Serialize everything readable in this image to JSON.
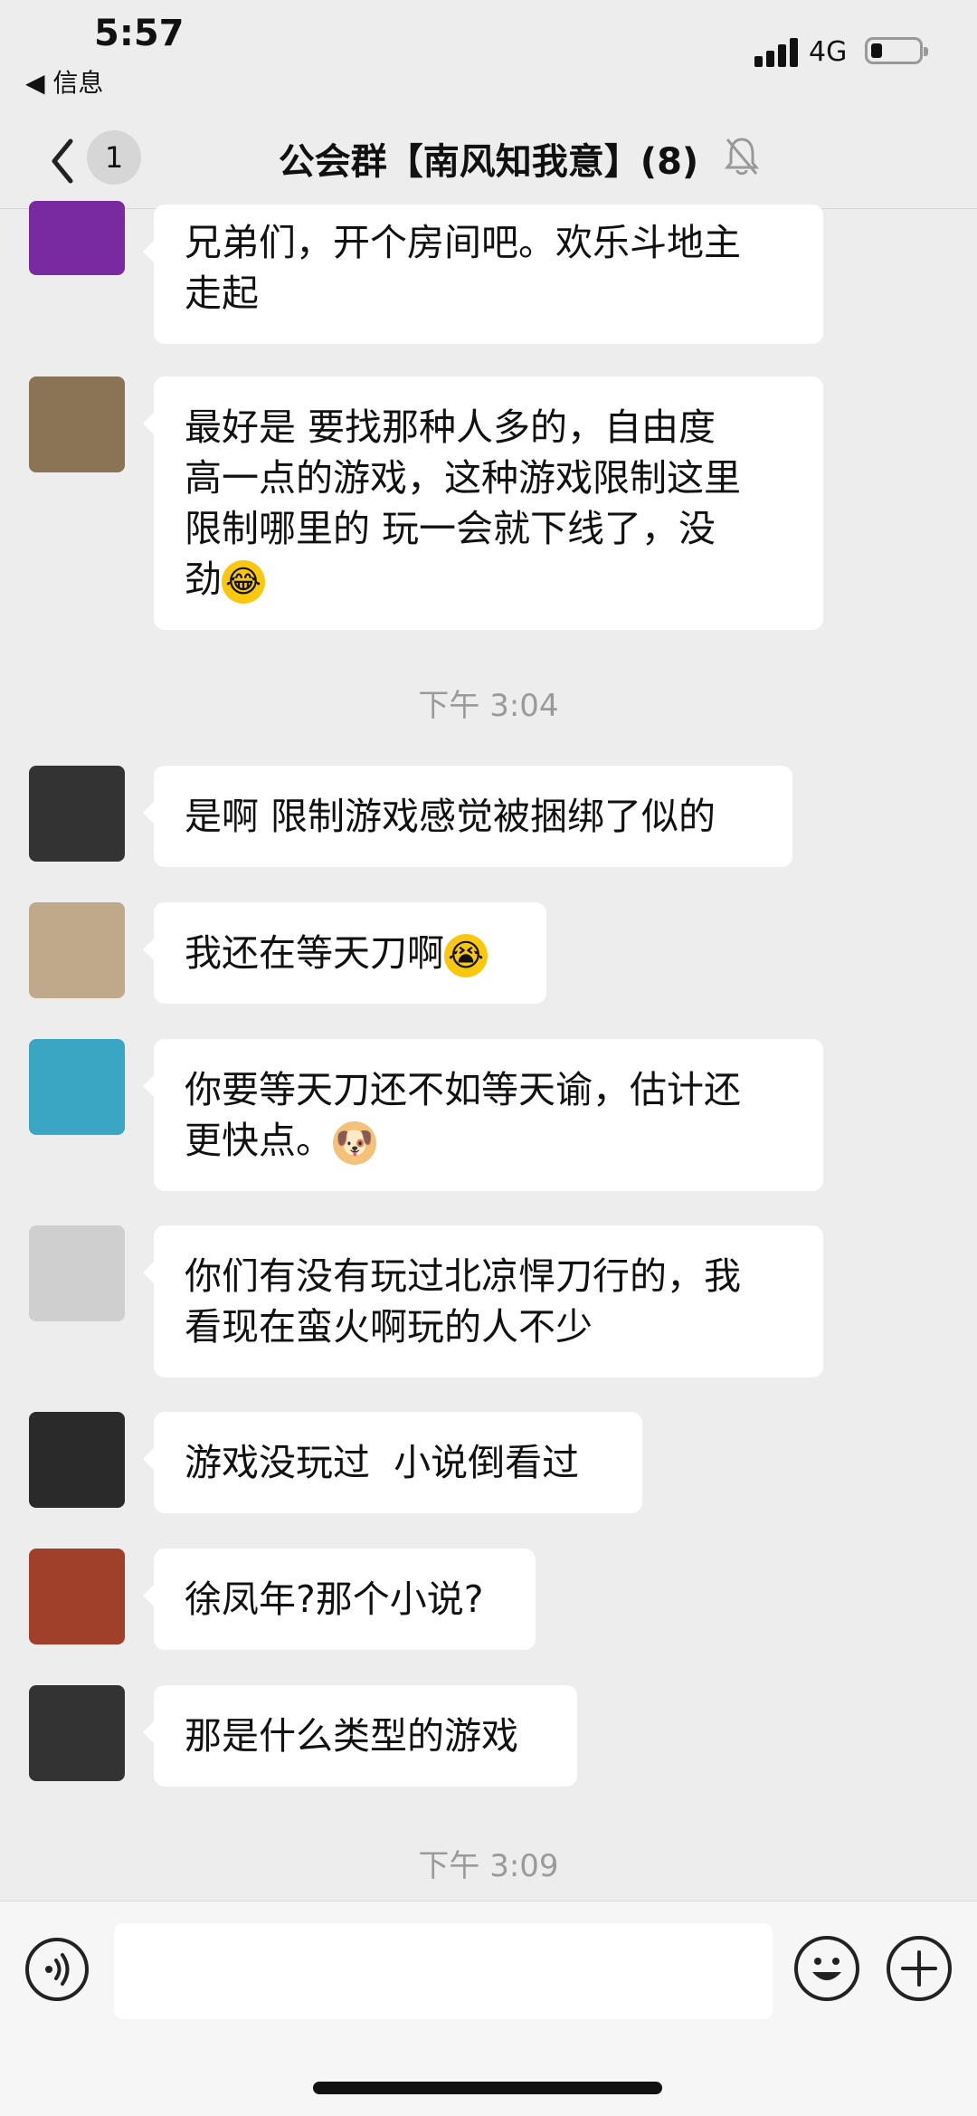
{
  "status_bar": {
    "time": "5:57",
    "back_app": "◀ 信息",
    "network": "4G"
  },
  "nav": {
    "unread_count": "1",
    "title": "公会群【南风知我意】(8)",
    "icons": [
      "back-icon",
      "mute-bell-icon"
    ]
  },
  "messages": [
    {
      "avatar_color": "#7a2aa0",
      "text": "兄弟们，开个房间吧。欢乐斗地主\n走起"
    },
    {
      "avatar_color": "#8b7355",
      "text": "最好是 要找那种人多的，自由度\n高一点的游戏，这种游戏限制这里\n限制哪里的 玩一会就下线了，没\n劲",
      "emoji": "😂"
    },
    {
      "avatar_color": "#333333",
      "text": "是啊 限制游戏感觉被捆绑了似的"
    },
    {
      "avatar_color": "#bfa98a",
      "text": "我还在等天刀啊",
      "emoji": "😭"
    },
    {
      "avatar_color": "#3aa6c4",
      "text": "你要等天刀还不如等天谕，估计还\n更快点。",
      "emoji": "🐶"
    },
    {
      "avatar_color": "#cfcfcf",
      "text": "你们有没有玩过北凉悍刀行的，我\n看现在蛮火啊玩的人不少"
    },
    {
      "avatar_color": "#2a2a2a",
      "text": "游戏没玩过  小说倒看过"
    },
    {
      "avatar_color": "#a0402a",
      "text": "徐凤年?那个小说?"
    },
    {
      "avatar_color": "#333333",
      "text": "那是什么类型的游戏"
    }
  ],
  "timestamps": [
    "下午 3:04",
    "下午 3:09"
  ],
  "input_bar": {
    "placeholder": "",
    "icons": [
      "voice-icon",
      "emoji-icon",
      "plus-icon"
    ]
  }
}
